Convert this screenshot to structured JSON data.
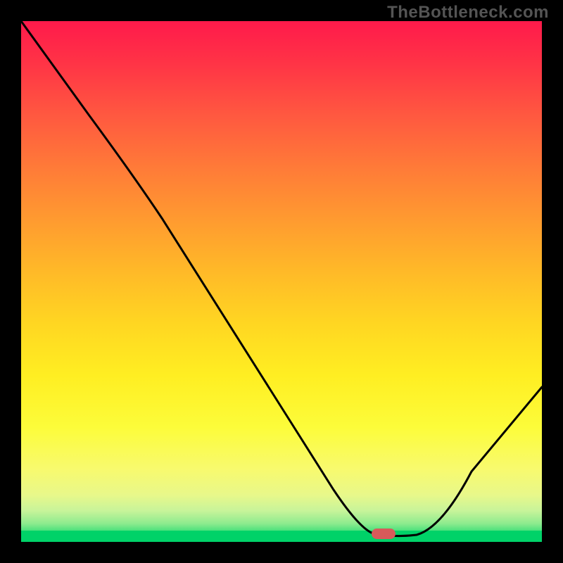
{
  "branding": {
    "watermark": "TheBottleneck.com"
  },
  "chart_data": {
    "type": "line",
    "title": "",
    "xlabel": "",
    "ylabel": "",
    "xlim": [
      0,
      100
    ],
    "ylim": [
      0,
      100
    ],
    "x": [
      0,
      13,
      22,
      30,
      40,
      50,
      60,
      66,
      70,
      76,
      82,
      90,
      100
    ],
    "values": [
      100,
      82,
      70,
      60,
      46,
      32,
      18,
      8,
      2,
      0,
      2,
      12,
      28
    ],
    "background_gradient": {
      "top": "#ff1a4b",
      "middle": "#ffee22",
      "bottom": "#00d268"
    },
    "marker": {
      "x_pct": 70,
      "color": "#d85a5a"
    },
    "grid": false,
    "legend": null
  }
}
